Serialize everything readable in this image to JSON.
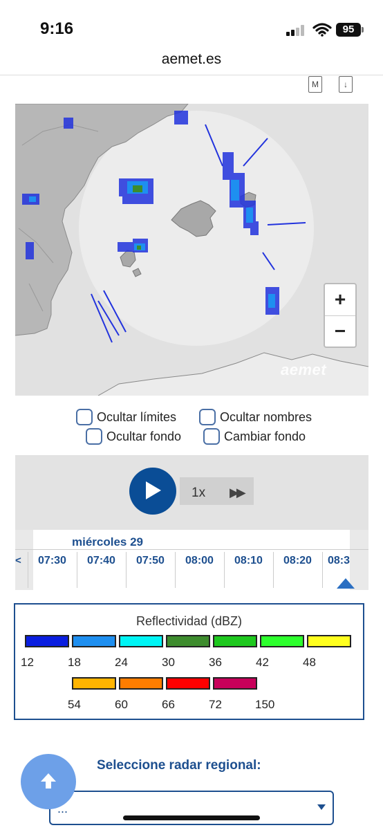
{
  "status_bar": {
    "time": "9:16",
    "battery": "95"
  },
  "browser": {
    "url": "aemet.es"
  },
  "toolbar_icons": {
    "m_icon_label": "M",
    "download_icon": "download-icon"
  },
  "map": {
    "zoom_in": "+",
    "zoom_out": "−",
    "watermark": "aemet"
  },
  "options": {
    "hide_limits": "Ocultar límites",
    "hide_names": "Ocultar nombres",
    "hide_background": "Ocultar fondo",
    "change_background": "Cambiar fondo"
  },
  "player": {
    "speed": "1x",
    "day": "miércoles 29",
    "left_arrow": "<",
    "times": [
      "07:30",
      "07:40",
      "07:50",
      "08:00",
      "08:10",
      "08:20",
      "08:3"
    ]
  },
  "legend": {
    "title": "Reflectividad (dBZ)",
    "row1_colors": [
      "#0a1ee0",
      "#1e8ff0",
      "#00f5f5",
      "#3d8c2d",
      "#1ec81e",
      "#2dff2d",
      "#ffff1e"
    ],
    "row1_values": [
      "12",
      "18",
      "24",
      "30",
      "36",
      "42",
      "48"
    ],
    "row2_colors": [
      "#ffb400",
      "#ff7d00",
      "#ff0000",
      "#c8005a"
    ],
    "row2_values": [
      "54",
      "60",
      "66",
      "72",
      "150"
    ]
  },
  "regional": {
    "label": "Seleccione radar regional:",
    "selected": "..."
  }
}
